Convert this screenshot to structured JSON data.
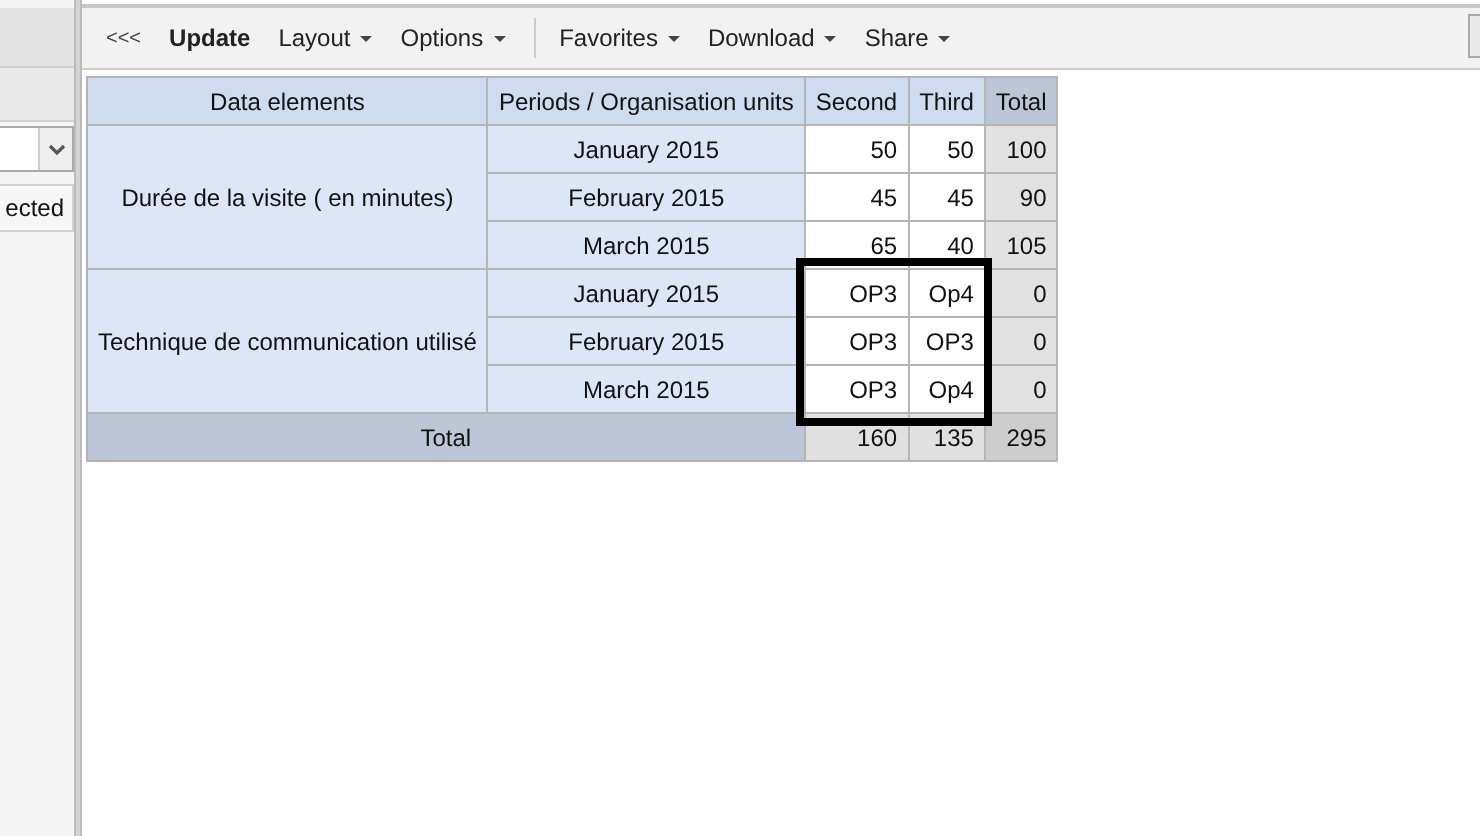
{
  "sidebar": {
    "selection_text": "ected"
  },
  "toolbar": [
    {
      "kind": "back",
      "label": "<<<"
    },
    {
      "kind": "button",
      "label": "Update"
    },
    {
      "kind": "menu",
      "label": "Layout"
    },
    {
      "kind": "menu",
      "label": "Options"
    },
    {
      "kind": "separator"
    },
    {
      "kind": "menu",
      "label": "Favorites"
    },
    {
      "kind": "menu",
      "label": "Download"
    },
    {
      "kind": "menu",
      "label": "Share"
    }
  ],
  "table": {
    "columns": [
      "Data elements",
      "Periods / Organisation units",
      "Second",
      "Third",
      "Total"
    ],
    "groups": [
      {
        "label": "Durée de la visite ( en minutes)",
        "rows": [
          {
            "period": "January 2015",
            "values": [
              "50",
              "50"
            ],
            "total": "100"
          },
          {
            "period": "February 2015",
            "values": [
              "45",
              "45"
            ],
            "total": "90"
          },
          {
            "period": "March 2015",
            "values": [
              "65",
              "40"
            ],
            "total": "105"
          }
        ]
      },
      {
        "label": "Technique de communication utilisé",
        "rows": [
          {
            "period": "January 2015",
            "values": [
              "OP3",
              "Op4"
            ],
            "total": "0"
          },
          {
            "period": "February 2015",
            "values": [
              "OP3",
              "OP3"
            ],
            "total": "0"
          },
          {
            "period": "March 2015",
            "values": [
              "OP3",
              "Op4"
            ],
            "total": "0"
          }
        ]
      }
    ],
    "total_row": {
      "label": "Total",
      "values": [
        "160",
        "135"
      ],
      "total": "295"
    }
  }
}
